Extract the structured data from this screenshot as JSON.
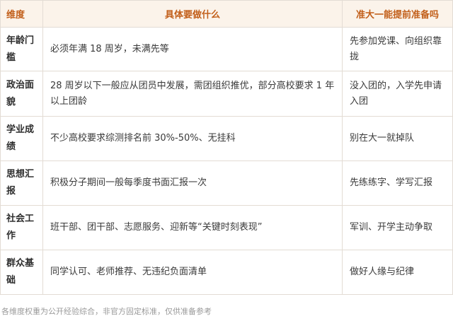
{
  "table": {
    "headers": [
      "维度",
      "具体要做什么",
      "准大一能提前准备吗"
    ],
    "rows": [
      {
        "dimension": "年龄门槛",
        "requirement": "必须年满 18 周岁，未满先等",
        "prepare": "先参加党课、向组织靠拢"
      },
      {
        "dimension": "政治面貌",
        "requirement": "28 周岁以下一般应从团员中发展，需团组织推优，部分高校要求 1 年以上团龄",
        "prepare": "没入团的，入学先申请入团"
      },
      {
        "dimension": "学业成绩",
        "requirement": "不少高校要求综测排名前 30%-50%、无挂科",
        "prepare": "别在大一就掉队"
      },
      {
        "dimension": "思想汇报",
        "requirement": "积极分子期间一般每季度书面汇报一次",
        "prepare": "先练练字、学写汇报"
      },
      {
        "dimension": "社会工作",
        "requirement": "班干部、团干部、志愿服务、迎新等“关键时刻表现”",
        "prepare": "军训、开学主动争取"
      },
      {
        "dimension": "群众基础",
        "requirement": "同学认可、老师推荐、无违纪负面清单",
        "prepare": "做好人缘与纪律"
      }
    ]
  },
  "footnote": "各维度权重为公开经验综合，非官方固定标准，仅供准备参考",
  "colors": {
    "header_text": "#c25f1a",
    "header_bg": "#fbf3ea",
    "border": "#e3dcd4"
  }
}
